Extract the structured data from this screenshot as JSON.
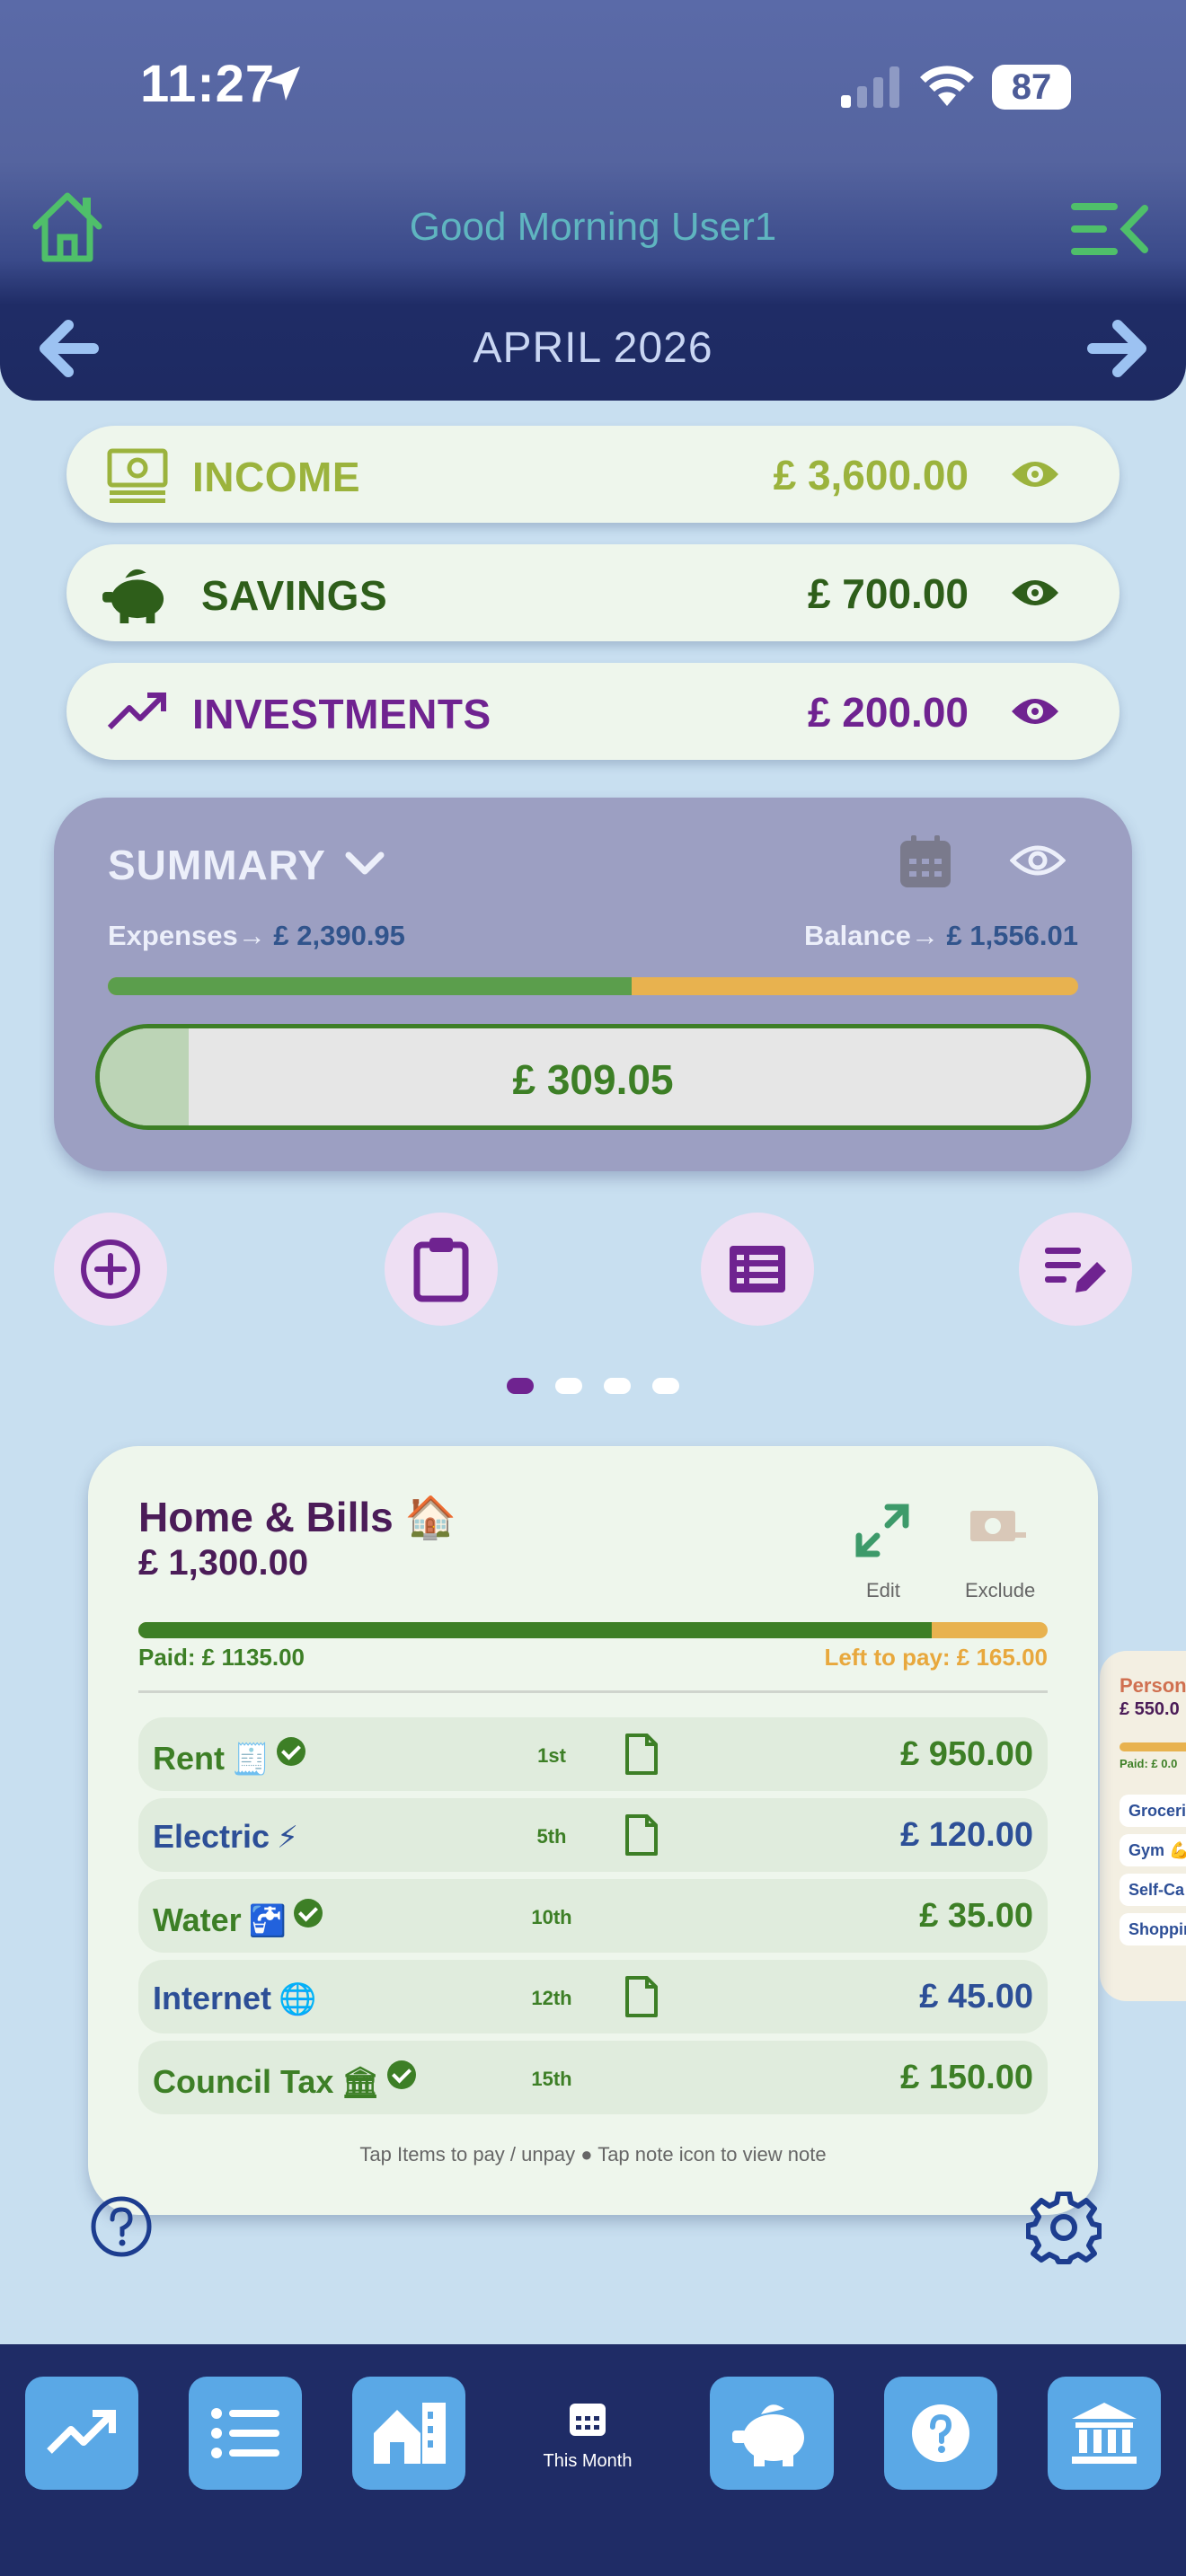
{
  "status": {
    "time": "11:27",
    "battery": "87"
  },
  "header": {
    "greeting": "Good Morning User1",
    "month": "APRIL 2026"
  },
  "categories": [
    {
      "label": "INCOME",
      "amount": "£ 3,600.00",
      "color": "#9bb33d"
    },
    {
      "label": "SAVINGS",
      "amount": "£ 700.00",
      "color": "#2e5e1a"
    },
    {
      "label": "INVESTMENTS",
      "amount": "£ 200.00",
      "color": "#6f2390"
    }
  ],
  "summary": {
    "title": "SUMMARY",
    "expenses_label": "Expenses→",
    "expenses_value": "£ 2,390.95",
    "balance_label": "Balance→",
    "balance_value": "£ 1,556.01",
    "expense_bar_fraction": 0.54,
    "remaining": "£ 309.05",
    "remaining_fraction": 0.09
  },
  "pager": {
    "count": 4,
    "active": 0
  },
  "bills_card": {
    "title": "Home & Bills",
    "title_emoji": "🏠",
    "total": "£ 1,300.00",
    "edit_label": "Edit",
    "exclude_label": "Exclude",
    "paid_label": "Paid: £ 1135.00",
    "left_label": "Left to pay: £ 165.00",
    "paid_fraction": 0.873,
    "hint": "Tap Items to pay / unpay ● Tap note icon to view note",
    "items": [
      {
        "name": "Rent",
        "emoji": "🧾",
        "day": "1st",
        "amount": "£ 950.00",
        "paid": true,
        "note": true
      },
      {
        "name": "Electric",
        "emoji": "⚡",
        "day": "5th",
        "amount": "£ 120.00",
        "paid": false,
        "note": true
      },
      {
        "name": "Water",
        "emoji": "🚰",
        "day": "10th",
        "amount": "£ 35.00",
        "paid": true,
        "note": false
      },
      {
        "name": "Internet",
        "emoji": "🌐",
        "day": "12th",
        "amount": "£ 45.00",
        "paid": false,
        "note": true
      },
      {
        "name": "Council Tax",
        "emoji": "🏛",
        "day": "15th",
        "amount": "£ 150.00",
        "paid": true,
        "note": false
      }
    ]
  },
  "peek_card": {
    "title": "Person",
    "total": "£ 550.0",
    "paid": "Paid: £ 0.0",
    "items": [
      "Groceri",
      "Gym 💪",
      "Self-Ca",
      "Shoppin"
    ]
  },
  "bottom_nav": {
    "center_label": "This Month"
  },
  "colors": {
    "header": "#1f2c66",
    "accent_green": "#3d7f26",
    "accent_orange": "#e8b24f",
    "accent_purple": "#6f2390",
    "nav_button": "#5aa8e6"
  }
}
